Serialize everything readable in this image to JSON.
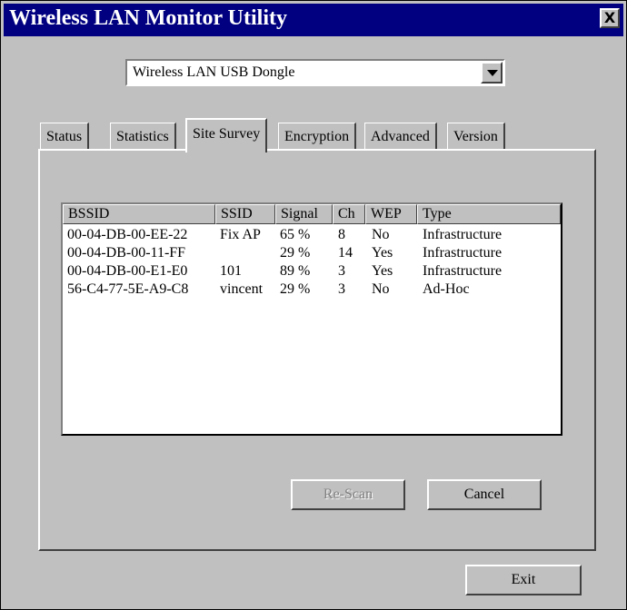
{
  "window": {
    "title": "Wireless LAN Monitor Utility",
    "close_label": "X"
  },
  "adapter": {
    "selected": "Wireless LAN USB Dongle"
  },
  "tabs": [
    {
      "label": "Status"
    },
    {
      "label": "Statistics"
    },
    {
      "label": "Site Survey",
      "active": true
    },
    {
      "label": "Encryption"
    },
    {
      "label": "Advanced"
    },
    {
      "label": "Version"
    }
  ],
  "survey": {
    "columns": [
      "BSSID",
      "SSID",
      "Signal",
      "Ch",
      "WEP",
      "Type"
    ],
    "rows": [
      [
        "00-04-DB-00-EE-22",
        "Fix AP",
        "65 %",
        "8",
        "No",
        "Infrastructure"
      ],
      [
        "00-04-DB-00-11-FF",
        "",
        "29 %",
        "14",
        "Yes",
        "Infrastructure"
      ],
      [
        "00-04-DB-00-E1-E0",
        "101",
        "89 %",
        "3",
        "Yes",
        "Infrastructure"
      ],
      [
        "56-C4-77-5E-A9-C8",
        "vincent",
        "29 %",
        "3",
        "No",
        "Ad-Hoc"
      ]
    ]
  },
  "buttons": {
    "rescan": "Re-Scan",
    "cancel": "Cancel",
    "exit": "Exit"
  }
}
